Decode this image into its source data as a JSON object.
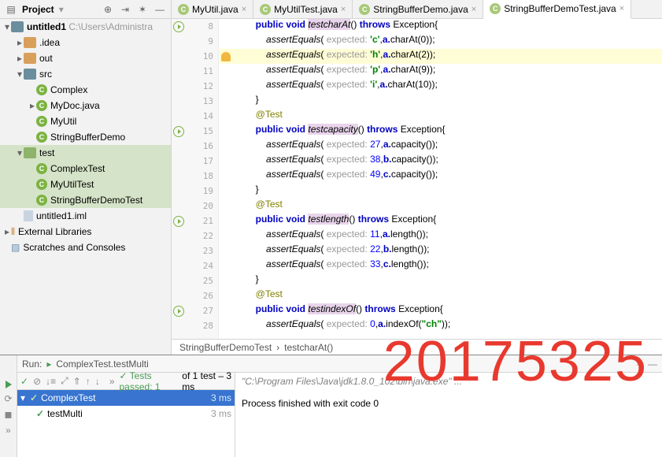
{
  "sidebar": {
    "title": "Project",
    "root": {
      "label": "untitled1",
      "path": "C:\\Users\\Administra"
    },
    "nodes": {
      "idea": ".idea",
      "out": "out",
      "src": "src",
      "complex": "Complex",
      "mydoc": "MyDoc.java",
      "myutil": "MyUtil",
      "sbd": "StringBufferDemo",
      "test": "test",
      "complextest": "ComplexTest",
      "myutiltest": "MyUtilTest",
      "sbdtest": "StringBufferDemoTest",
      "iml": "untitled1.iml",
      "extlib": "External Libraries",
      "scratch": "Scratches and Consoles"
    }
  },
  "tabs": [
    {
      "label": "MyUtil.java"
    },
    {
      "label": "MyUtilTest.java"
    },
    {
      "label": "StringBufferDemo.java"
    },
    {
      "label": "StringBufferDemoTest.java"
    }
  ],
  "code": {
    "lines": [
      {
        "n": 8,
        "run": true,
        "pre": "        ",
        "kw1": "public void",
        "m": " ",
        "name": "testcharAt",
        "post": "() ",
        "kw2": "throws",
        "exc": " Exception{"
      },
      {
        "n": 9,
        "pre": "            ",
        "fn": "assertEquals",
        "p": "( ",
        "hint": "expected:",
        "sp": " ",
        "val": "'c'",
        "cm": ",",
        "obj": "a.",
        "call": "charAt",
        "arg": "(0));"
      },
      {
        "n": 10,
        "hl": true,
        "bulb": true,
        "pre": "            ",
        "fn": "assertEquals",
        "p": "( ",
        "hint": "expected:",
        "sp": " ",
        "val": "'h'",
        "cm": ",",
        "obj": "a.",
        "call": "charAt",
        "arg": "(2));"
      },
      {
        "n": 11,
        "pre": "            ",
        "fn": "assertEquals",
        "p": "( ",
        "hint": "expected:",
        "sp": " ",
        "val": "'p'",
        "cm": ",",
        "obj": "a.",
        "call": "charAt",
        "arg": "(9));"
      },
      {
        "n": 12,
        "pre": "            ",
        "fn": "assertEquals",
        "p": "( ",
        "hint": "expected:",
        "sp": " ",
        "val": "'i'",
        "cm": ",",
        "obj": "a.",
        "call": "charAt",
        "arg": "(10));"
      },
      {
        "n": 13,
        "pre": "        }",
        "plain": true
      },
      {
        "n": 14,
        "pre": "        ",
        "ann": "@Test"
      },
      {
        "n": 15,
        "run": true,
        "pre": "        ",
        "kw1": "public void",
        "m": " ",
        "name": "testcapacity",
        "post": "() ",
        "kw2": "throws",
        "exc": " Exception{"
      },
      {
        "n": 16,
        "pre": "            ",
        "fn": "assertEquals",
        "p": "( ",
        "hint": "expected:",
        "sp": " ",
        "valnum": "27",
        "cm": ",",
        "obj": "a.",
        "call": "capacity",
        "arg": "());"
      },
      {
        "n": 17,
        "pre": "            ",
        "fn": "assertEquals",
        "p": "( ",
        "hint": "expected:",
        "sp": " ",
        "valnum": "38",
        "cm": ",",
        "obj": "b.",
        "call": "capacity",
        "arg": "());"
      },
      {
        "n": 18,
        "pre": "            ",
        "fn": "assertEquals",
        "p": "( ",
        "hint": "expected:",
        "sp": " ",
        "valnum": "49",
        "cm": ",",
        "obj": "c.",
        "call": "capacity",
        "arg": "());"
      },
      {
        "n": 19,
        "pre": "        }",
        "plain": true
      },
      {
        "n": 20,
        "pre": "        ",
        "ann": "@Test"
      },
      {
        "n": 21,
        "run": true,
        "pre": "        ",
        "kw1": "public void",
        "m": " ",
        "name": "testlength",
        "post": "() ",
        "kw2": "throws",
        "exc": " Exception{"
      },
      {
        "n": 22,
        "pre": "            ",
        "fn": "assertEquals",
        "p": "( ",
        "hint": "expected:",
        "sp": " ",
        "valnum": "11",
        "cm": ",",
        "obj": "a.",
        "call": "length",
        "arg": "());"
      },
      {
        "n": 23,
        "pre": "            ",
        "fn": "assertEquals",
        "p": "( ",
        "hint": "expected:",
        "sp": " ",
        "valnum": "22",
        "cm": ",",
        "obj": "b.",
        "call": "length",
        "arg": "());"
      },
      {
        "n": 24,
        "pre": "            ",
        "fn": "assertEquals",
        "p": "( ",
        "hint": "expected:",
        "sp": " ",
        "valnum": "33",
        "cm": ",",
        "obj": "c.",
        "call": "length",
        "arg": "());"
      },
      {
        "n": 25,
        "pre": "        }",
        "plain": true
      },
      {
        "n": 26,
        "pre": "        ",
        "ann": "@Test"
      },
      {
        "n": 27,
        "run": true,
        "pre": "        ",
        "kw1": "public void",
        "m": " ",
        "name": "testindexOf",
        "post": "() ",
        "kw2": "throws",
        "exc": " Exception{"
      },
      {
        "n": 28,
        "pre": "            ",
        "fn": "assertEquals",
        "p": "( ",
        "hint": "expected:",
        "sp": " ",
        "valnum": "0",
        "cm": ",",
        "obj": "a.",
        "call": "indexOf",
        "arg": "(",
        "str2": "\"ch\"",
        "tail": "));"
      }
    ]
  },
  "breadcrumb": {
    "a": "StringBufferDemoTest",
    "b": "testcharAt()"
  },
  "run": {
    "label": "Run:",
    "config": "ComplexTest.testMulti",
    "pass": "Tests passed: 1",
    "passOf": " of 1 test – 3 ms",
    "tree": [
      {
        "label": "ComplexTest",
        "time": "3 ms",
        "sel": true
      },
      {
        "label": "testMulti",
        "time": "3 ms",
        "indent": true
      }
    ],
    "cmd": "\"C:\\Program Files\\Java\\jdk1.8.0_102\\bin\\java.exe\" ...",
    "exit": "Process finished with exit code 0"
  },
  "overlay": "20175325"
}
